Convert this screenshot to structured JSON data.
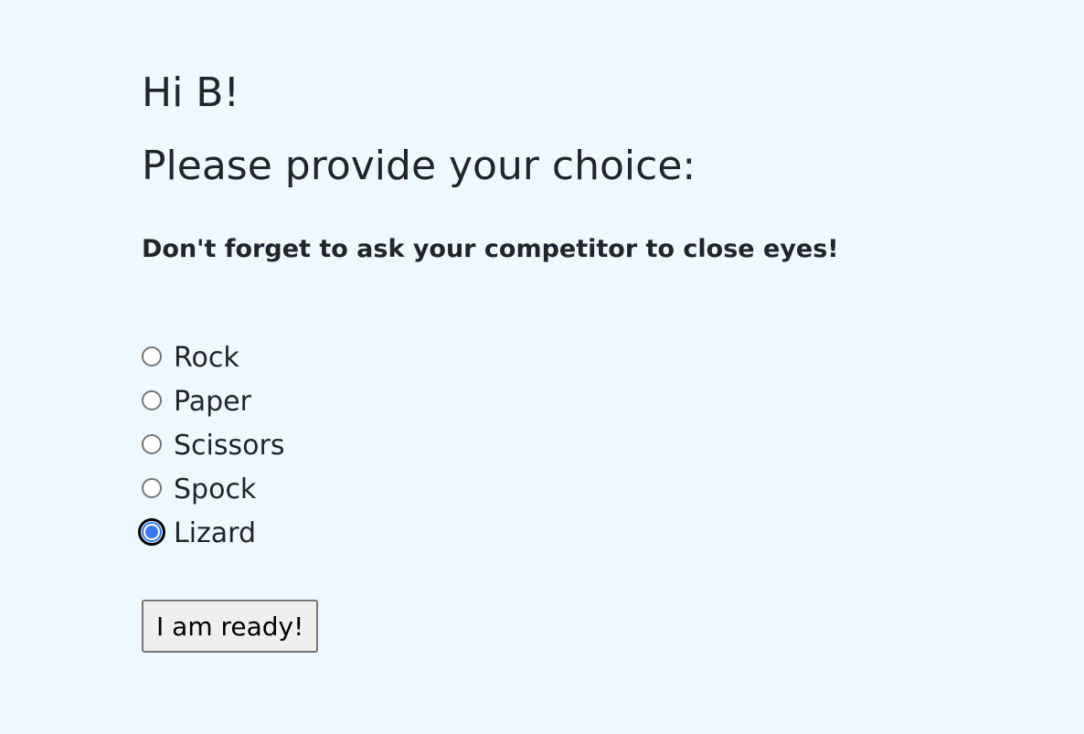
{
  "header": {
    "greeting": "Hi B!",
    "prompt": "Please provide your choice:",
    "warning": "Don't forget to ask your competitor to close eyes!"
  },
  "choices": {
    "selected": "Lizard",
    "options": [
      {
        "label": "Rock",
        "checked": false
      },
      {
        "label": "Paper",
        "checked": false
      },
      {
        "label": "Scissors",
        "checked": false
      },
      {
        "label": "Spock",
        "checked": false
      },
      {
        "label": "Lizard",
        "checked": true
      }
    ]
  },
  "actions": {
    "ready_label": "I am ready!"
  },
  "colors": {
    "background": "#f0f8ff",
    "text": "#212529",
    "radio_accent": "#3a77f2",
    "button_bg": "#efefef"
  }
}
